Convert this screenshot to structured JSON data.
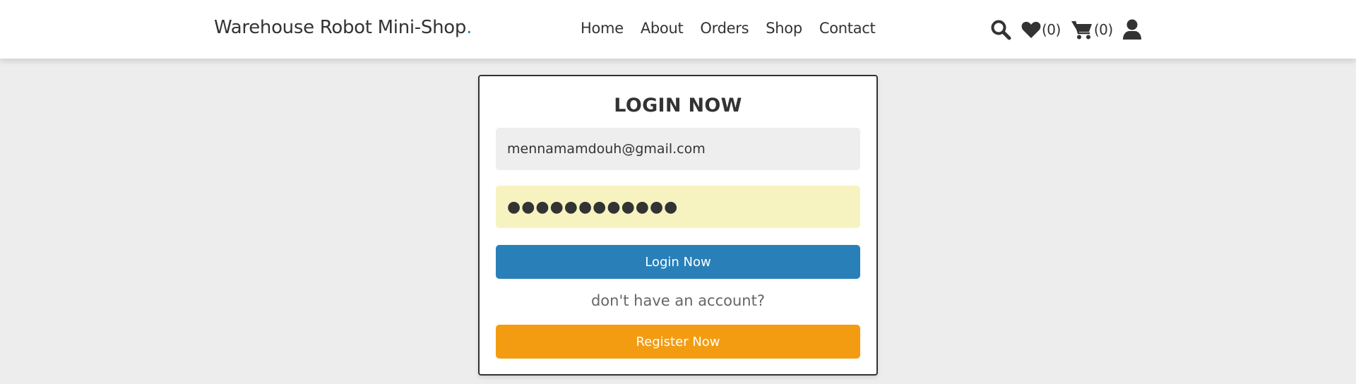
{
  "header": {
    "logo_text": "Warehouse Robot Mini-Shop",
    "logo_dot": ".",
    "nav": [
      {
        "label": "Home"
      },
      {
        "label": "About"
      },
      {
        "label": "Orders"
      },
      {
        "label": "Shop"
      },
      {
        "label": "Contact"
      }
    ],
    "icons": {
      "search": "search-icon",
      "wishlist": "heart-icon",
      "wishlist_count": "(0)",
      "cart": "cart-icon",
      "cart_count": "(0)",
      "user": "user-icon"
    }
  },
  "login": {
    "title": "LOGIN NOW",
    "email_value": "mennamamdouh@gmail.com",
    "password_value": "●●●●●●●●●●●●",
    "login_button": "Login Now",
    "hint": "don't have an account?",
    "register_button": "Register Now"
  },
  "colors": {
    "accent_blue": "#2980b9",
    "accent_orange": "#f39c12",
    "autofill_yellow": "#f7f3c0"
  }
}
